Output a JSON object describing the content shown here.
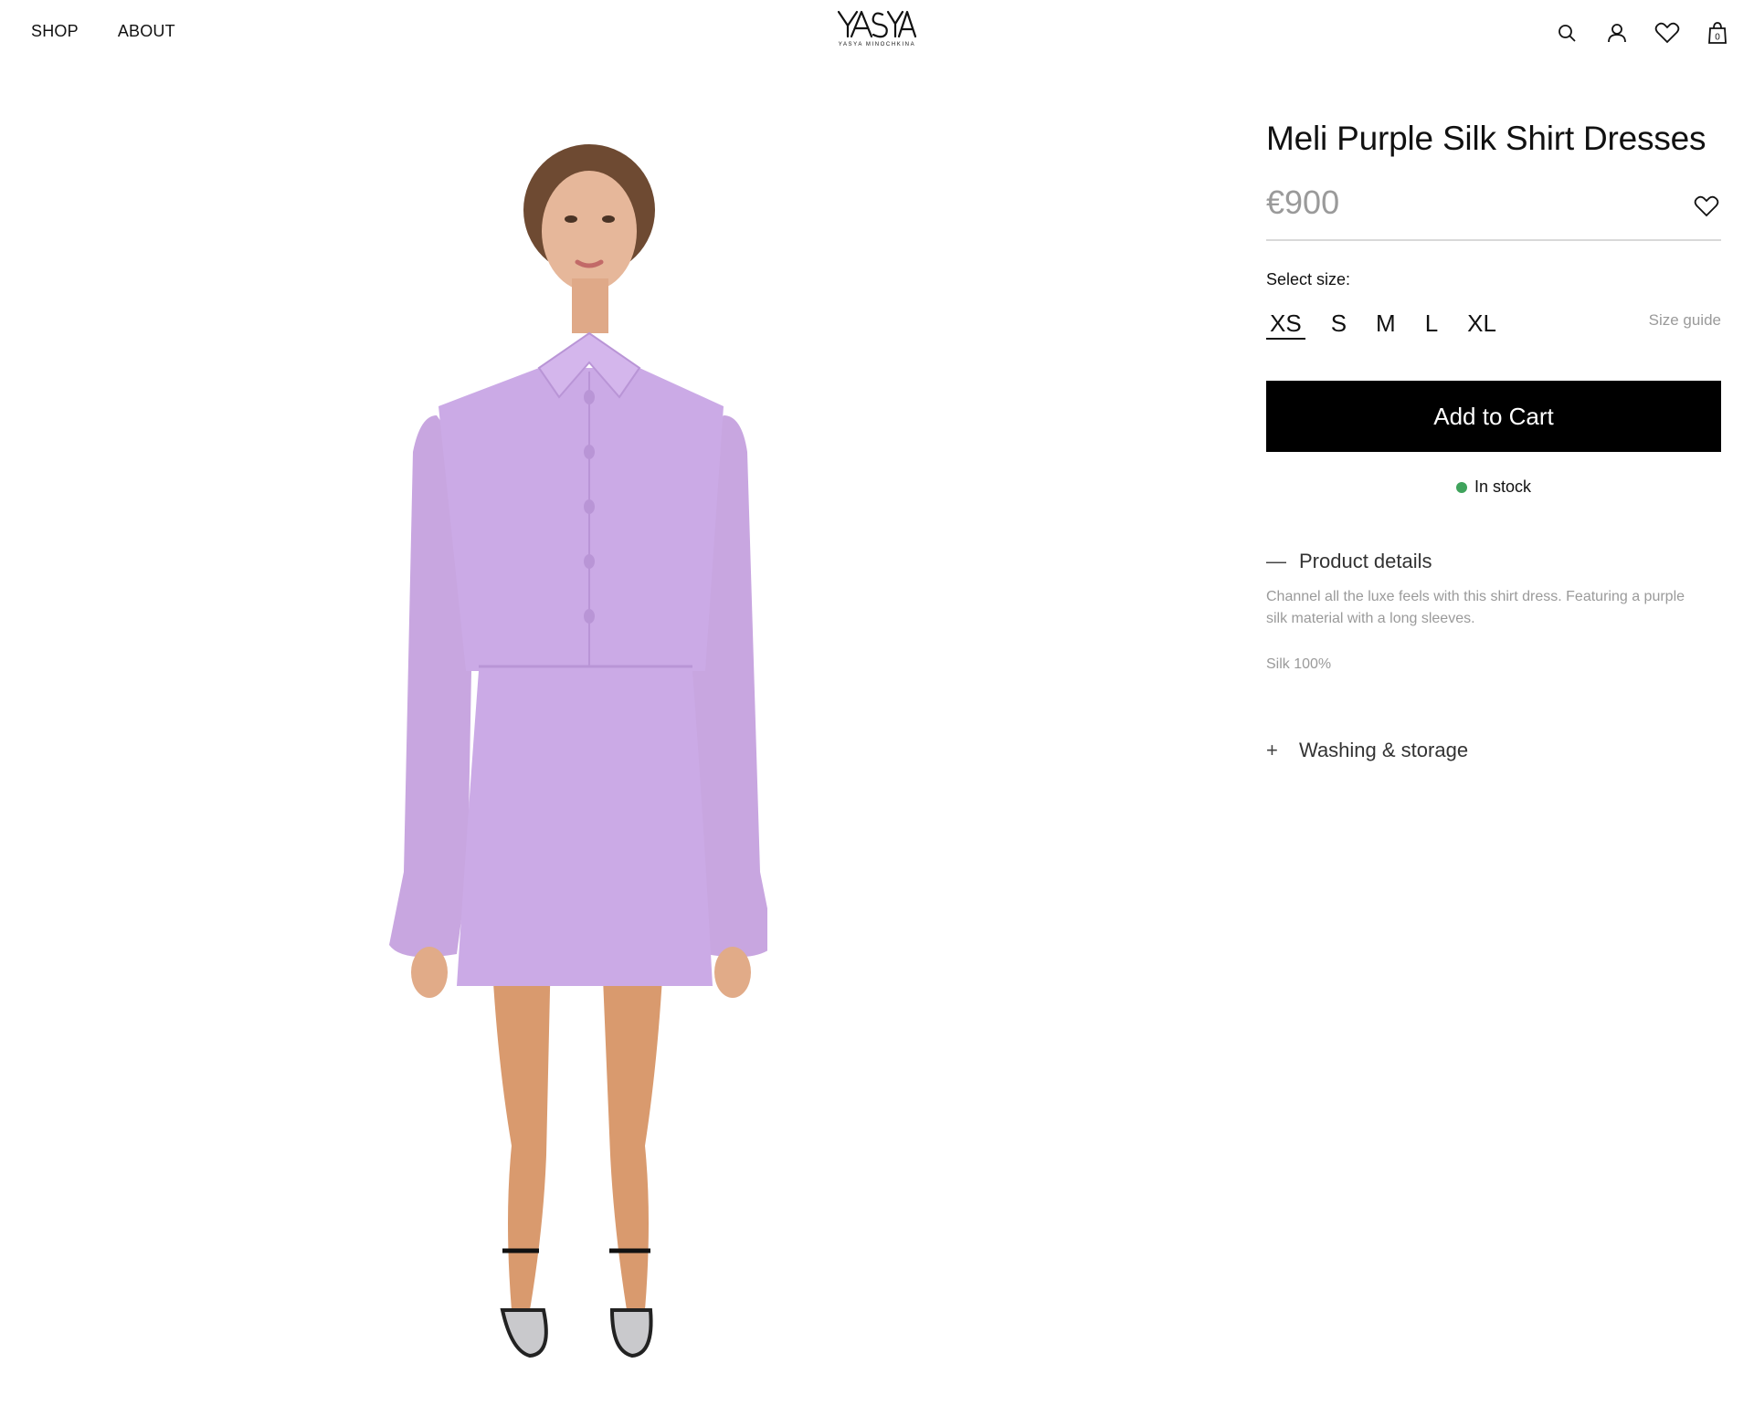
{
  "nav": {
    "shop": "SHOP",
    "about": "ABOUT"
  },
  "logo": {
    "mark": "YASYA",
    "subtitle": "YASYA MINOCHKINA"
  },
  "header_icons": [
    "search-icon",
    "account-icon",
    "wishlist-icon",
    "cart-bag-icon"
  ],
  "cart_count": "0",
  "product": {
    "title": "Meli Purple Silk Shirt Dresses",
    "price": "€900",
    "size_label": "Select size:",
    "sizes": [
      "XS",
      "S",
      "M",
      "L",
      "XL"
    ],
    "selected_size": "XS",
    "size_guide": "Size guide",
    "add_to_cart": "Add to Cart",
    "stock": "In stock",
    "stock_color": "#3fa35c"
  },
  "accordion": {
    "details": {
      "sign": "—",
      "title": "Product details",
      "body": "Channel all the luxe feels with this shirt dress. Featuring a purple silk material with a long sleeves.",
      "composition": "Silk 100%"
    },
    "washing": {
      "sign": "+",
      "title": "Washing & storage"
    }
  },
  "colors": {
    "dress": "#c9a9e3",
    "button": "#000000",
    "muted_text": "#9a9a9a"
  }
}
